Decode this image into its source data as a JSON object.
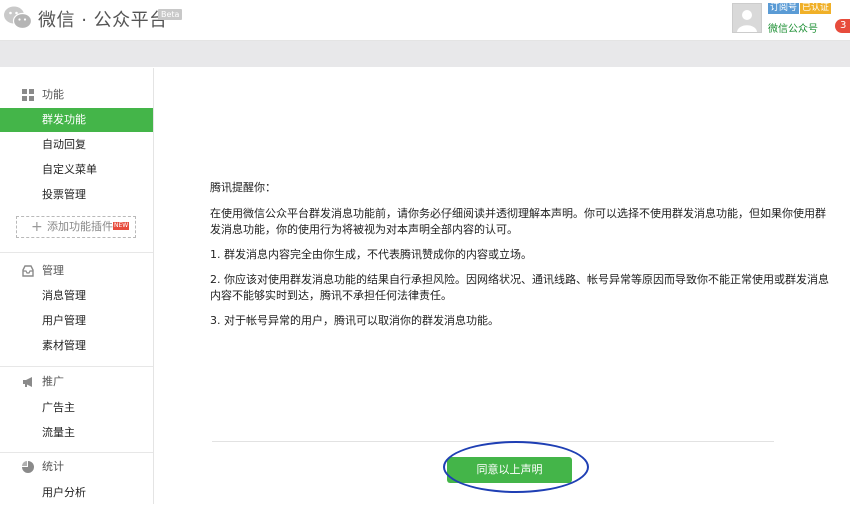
{
  "header": {
    "brand": "微信 · 公众平台",
    "beta_label": "Beta",
    "account_type_badge": "订阅号",
    "verified_badge": "已认证",
    "account_name": "微信公众号",
    "message_count": "3"
  },
  "sidebar": {
    "sections": [
      {
        "title": "功能",
        "icon": "grid-icon",
        "items": [
          {
            "label": "群发功能",
            "active": true
          },
          {
            "label": "自动回复",
            "active": false
          },
          {
            "label": "自定义菜单",
            "active": false
          },
          {
            "label": "投票管理",
            "active": false
          }
        ],
        "add_plugin": {
          "label": "添加功能插件",
          "new_badge": "NEW"
        }
      },
      {
        "title": "管理",
        "icon": "inbox-icon",
        "items": [
          {
            "label": "消息管理",
            "active": false
          },
          {
            "label": "用户管理",
            "active": false
          },
          {
            "label": "素材管理",
            "active": false
          }
        ]
      },
      {
        "title": "推广",
        "icon": "megaphone-icon",
        "items": [
          {
            "label": "广告主",
            "active": false
          },
          {
            "label": "流量主",
            "active": false
          }
        ]
      },
      {
        "title": "统计",
        "icon": "pie-chart-icon",
        "items": [
          {
            "label": "用户分析",
            "active": false
          }
        ]
      }
    ]
  },
  "main": {
    "notice_title": "腾讯提醒你：",
    "paragraphs": [
      "在使用微信公众平台群发消息功能前，请你务必仔细阅读并透彻理解本声明。你可以选择不使用群发消息功能，但如果你使用群发消息功能，你的使用行为将被视为对本声明全部内容的认可。",
      "1. 群发消息内容完全由你生成，不代表腾讯赞成你的内容或立场。",
      "2. 你应该对使用群发消息功能的结果自行承担风险。因网络状况、通讯线路、帐号异常等原因而导致你不能正常使用或群发消息内容不能够实时到达，腾讯不承担任何法律责任。",
      "3. 对于帐号异常的用户，腾讯可以取消你的群发消息功能。"
    ],
    "agree_button": "同意以上声明"
  },
  "colors": {
    "accent_green": "#44b549",
    "highlight_ring": "#1f3fb4",
    "badge_blue": "#5a9bd5",
    "badge_orange": "#f0b028",
    "alert_red": "#e74c3c"
  }
}
